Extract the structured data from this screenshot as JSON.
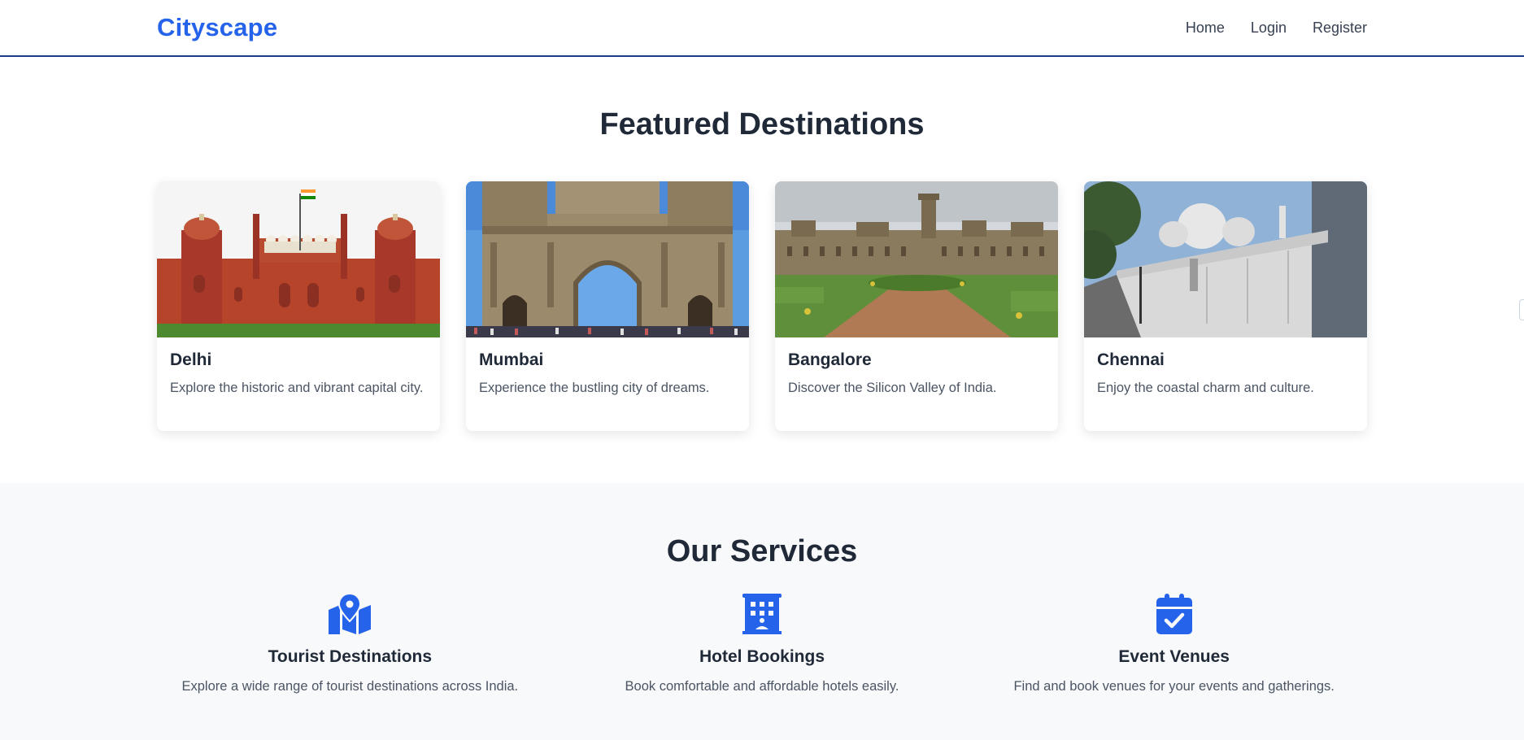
{
  "navbar": {
    "brand": "Cityscape",
    "links": [
      {
        "label": "Home"
      },
      {
        "label": "Login"
      },
      {
        "label": "Register"
      }
    ]
  },
  "featured": {
    "title": "Featured Destinations",
    "cards": [
      {
        "title": "Delhi",
        "text": "Explore the historic and vibrant capital city.",
        "image": "red-fort"
      },
      {
        "title": "Mumbai",
        "text": "Experience the bustling city of dreams.",
        "image": "gateway-of-india"
      },
      {
        "title": "Bangalore",
        "text": "Discover the Silicon Valley of India.",
        "image": "bangalore-palace"
      },
      {
        "title": "Chennai",
        "text": "Enjoy the coastal charm and culture.",
        "image": "white-mosque"
      }
    ]
  },
  "services": {
    "title": "Our Services",
    "items": [
      {
        "title": "Tourist Destinations",
        "text": "Explore a wide range of tourist destinations across India.",
        "icon": "map-location-icon"
      },
      {
        "title": "Hotel Bookings",
        "text": "Book comfortable and affordable hotels easily.",
        "icon": "hotel-icon"
      },
      {
        "title": "Event Venues",
        "text": "Find and book venues for your events and gatherings.",
        "icon": "calendar-check-icon"
      }
    ]
  },
  "colors": {
    "brand": "#2563eb",
    "nav_border": "#1e3a8a",
    "heading": "#1f2937",
    "body_text": "#4b5563",
    "services_bg": "#f8f9fb"
  }
}
